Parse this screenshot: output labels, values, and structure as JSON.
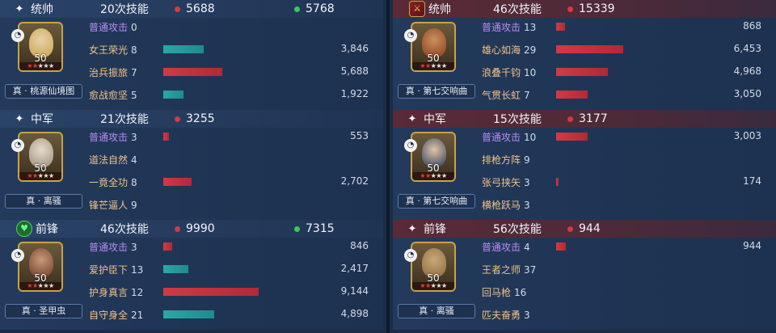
{
  "left": {
    "sections": [
      {
        "symbol": "✦",
        "position": "统帅",
        "skill_count": "20次技能",
        "damage": "5688",
        "heal": "5768",
        "level": "50",
        "tag": "真 · 桃源仙境图",
        "skills": [
          {
            "name": "普通攻击",
            "count": "0",
            "value": "",
            "bar": 0,
            "color": "red",
            "basic": true
          },
          {
            "name": "女王荣光",
            "count": "8",
            "value": "3,846",
            "bar": 0.42,
            "color": "teal"
          },
          {
            "name": "治兵振旅",
            "count": "7",
            "value": "5,688",
            "bar": 0.62,
            "color": "red"
          },
          {
            "name": "愈战愈坚",
            "count": "5",
            "value": "1,922",
            "bar": 0.21,
            "color": "teal"
          }
        ]
      },
      {
        "symbol": "✦",
        "position": "中军",
        "skill_count": "21次技能",
        "damage": "3255",
        "heal": "",
        "level": "50",
        "tag": "真 · 离骚",
        "skills": [
          {
            "name": "普通攻击",
            "count": "3",
            "value": "553",
            "bar": 0.06,
            "color": "red",
            "basic": true
          },
          {
            "name": "道法自然",
            "count": "4",
            "value": "",
            "bar": 0,
            "color": "red"
          },
          {
            "name": "一竟全功",
            "count": "8",
            "value": "2,702",
            "bar": 0.3,
            "color": "red"
          },
          {
            "name": "锋芒逼人",
            "count": "9",
            "value": "",
            "bar": 0,
            "color": "red"
          }
        ]
      },
      {
        "symbol": "♥",
        "position": "前锋",
        "skill_count": "46次技能",
        "damage": "9990",
        "heal": "7315",
        "level": "50",
        "tag": "真 · 圣甲虫",
        "skills": [
          {
            "name": "普通攻击",
            "count": "3",
            "value": "846",
            "bar": 0.09,
            "color": "red",
            "basic": true
          },
          {
            "name": "爱护臣下",
            "count": "13",
            "value": "2,417",
            "bar": 0.26,
            "color": "teal"
          },
          {
            "name": "护身真言",
            "count": "12",
            "value": "9,144",
            "bar": 1.0,
            "color": "red"
          },
          {
            "name": "自守身全",
            "count": "21",
            "value": "4,898",
            "bar": 0.53,
            "color": "teal"
          }
        ]
      }
    ]
  },
  "right": {
    "sections": [
      {
        "symbol": "⚔",
        "position": "统帅",
        "skill_count": "46次技能",
        "damage": "15339",
        "heal": "",
        "level": "50",
        "tag": "真 · 第七交响曲",
        "skills": [
          {
            "name": "普通攻击",
            "count": "13",
            "value": "868",
            "bar": 0.09,
            "color": "red",
            "basic": true
          },
          {
            "name": "雄心如海",
            "count": "29",
            "value": "6,453",
            "bar": 0.7,
            "color": "red"
          },
          {
            "name": "浪叠千钧",
            "count": "10",
            "value": "4,968",
            "bar": 0.54,
            "color": "red"
          },
          {
            "name": "气贯长虹",
            "count": "7",
            "value": "3,050",
            "bar": 0.33,
            "color": "red"
          }
        ]
      },
      {
        "symbol": "✦",
        "position": "中军",
        "skill_count": "15次技能",
        "damage": "3177",
        "heal": "",
        "level": "50",
        "tag": "真 · 第七交响曲",
        "skills": [
          {
            "name": "普通攻击",
            "count": "10",
            "value": "3,003",
            "bar": 0.33,
            "color": "red",
            "basic": true
          },
          {
            "name": "排枪方阵",
            "count": "9",
            "value": "",
            "bar": 0,
            "color": "red"
          },
          {
            "name": "张弓挟矢",
            "count": "3",
            "value": "174",
            "bar": 0.02,
            "color": "red"
          },
          {
            "name": "横枪跃马",
            "count": "3",
            "value": "",
            "bar": 0,
            "color": "red"
          }
        ]
      },
      {
        "symbol": "✦",
        "position": "前锋",
        "skill_count": "56次技能",
        "damage": "944",
        "heal": "",
        "level": "50",
        "tag": "真 · 离骚",
        "skills": [
          {
            "name": "普通攻击",
            "count": "4",
            "value": "944",
            "bar": 0.1,
            "color": "red",
            "basic": true
          },
          {
            "name": "王者之师",
            "count": "37",
            "value": "",
            "bar": 0,
            "color": "red"
          },
          {
            "name": "回马枪",
            "count": "16",
            "value": "",
            "bar": 0,
            "color": "red"
          },
          {
            "name": "匹夫奋勇",
            "count": "3",
            "value": "",
            "bar": 0,
            "color": "red"
          }
        ]
      }
    ]
  },
  "colors": {
    "damage_dot": "#d23a44",
    "heal_dot": "#3cc85a",
    "basic_attack": "#b98cf2",
    "skill_name": "#f0c28a"
  }
}
